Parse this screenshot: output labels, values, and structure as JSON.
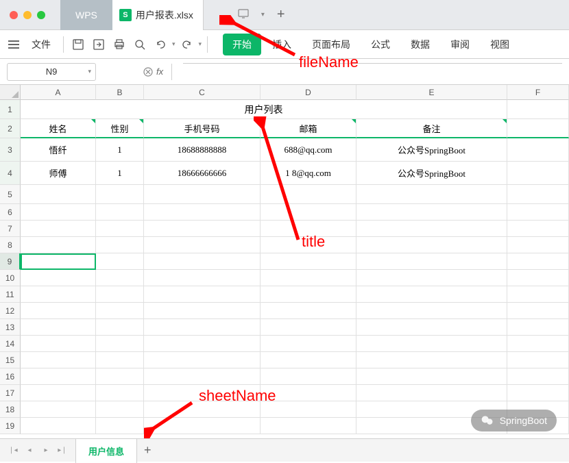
{
  "title_bar": {
    "wps_label": "WPS",
    "file_name": "用户报表.xlsx",
    "file_icon_letter": "S"
  },
  "toolbar": {
    "file_menu": "文件",
    "tabs": [
      "开始",
      "插入",
      "页面布局",
      "公式",
      "数据",
      "审阅",
      "视图"
    ]
  },
  "formula_bar": {
    "cell_ref": "N9",
    "fx_label": "fx"
  },
  "columns": [
    "A",
    "B",
    "C",
    "D",
    "E",
    "F"
  ],
  "row_count": 19,
  "selected_row": 9,
  "chart_data": {
    "type": "table",
    "title": "用户列表",
    "headers": [
      "姓名",
      "性别",
      "手机号码",
      "邮箱",
      "备注"
    ],
    "rows": [
      {
        "name": "悟纤",
        "gender": "1",
        "phone": "18688888888",
        "email": "688@qq.com",
        "remark": "公众号SpringBoot"
      },
      {
        "name": "师傅",
        "gender": "1",
        "phone": "18666666666",
        "email": "1 8@qq.com",
        "remark": "公众号SpringBoot"
      }
    ]
  },
  "sheet": {
    "name": "用户信息"
  },
  "annotations": {
    "file_name_label": "fileName",
    "title_label": "title",
    "sheet_name_label": "sheetName"
  },
  "watermark": {
    "text": "SpringBoot"
  }
}
